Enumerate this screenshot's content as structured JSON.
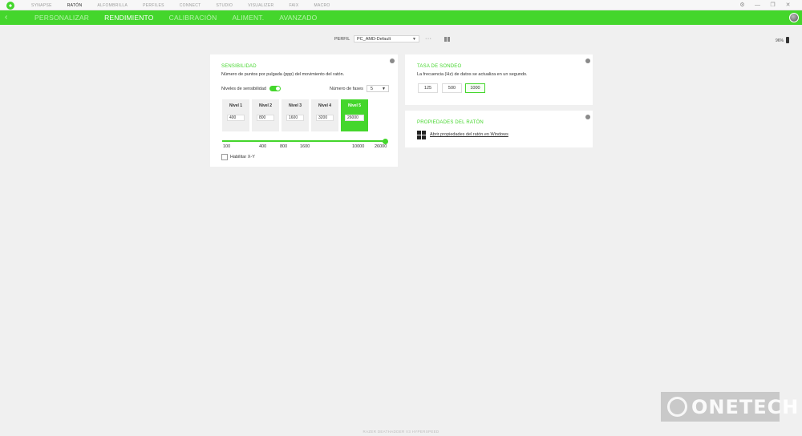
{
  "topnav": {
    "items": [
      "SYNAPSE",
      "RATÓN",
      "ALFOMBRILLA",
      "PERFILES",
      "CONNECT",
      "STUDIO",
      "VISUALIZER",
      "FAIX",
      "MACRO"
    ],
    "active_index": 1
  },
  "window_controls": {
    "settings": "⚙",
    "minimize": "—",
    "maximize": "❐",
    "close": "✕"
  },
  "subnav": {
    "back": "‹",
    "tabs": [
      "PERSONALIZAR",
      "RENDIMIENTO",
      "CALIBRACIÓN",
      "ALIMENT.",
      "AVANZADO"
    ],
    "active_index": 1
  },
  "profile": {
    "label": "PERFIL",
    "value": "PC_AMD-Default",
    "more": "···"
  },
  "battery": {
    "text": "96%"
  },
  "sensitivity": {
    "title": "SENSIBILIDAD",
    "description": "Número de puntos por pulgada (ppp) del movimiento del ratón.",
    "toggle_label": "Niveles de sensibilidad",
    "toggle_on": true,
    "stages_label": "Número de fases",
    "stages_value": "5",
    "levels": [
      {
        "name": "Nivel 1",
        "value": "400"
      },
      {
        "name": "Nivel 2",
        "value": "800"
      },
      {
        "name": "Nivel 3",
        "value": "1600"
      },
      {
        "name": "Nivel 4",
        "value": "3200"
      },
      {
        "name": "Nivel 5",
        "value": "26000"
      }
    ],
    "active_level_index": 4,
    "slider_ticks": [
      "100",
      "400",
      "800",
      "1600",
      "10000",
      "26000"
    ],
    "slider_value": 26000,
    "xy_label": "Habilitar X-Y",
    "xy_checked": false
  },
  "polling": {
    "title": "TASA DE SONDEO",
    "description": "La frecuencia (Hz) de datos se actualiza en un segundo.",
    "options": [
      "125",
      "500",
      "1000"
    ],
    "selected_index": 2
  },
  "mouse_properties": {
    "title": "PROPIEDADES DEL RATÓN",
    "link": "Abrir propiedades del ratón en Windows"
  },
  "watermark": {
    "text": "ONETECH"
  },
  "footer": {
    "text": "RAZER DEATHADDER V3 HYPERSPEED"
  },
  "colors": {
    "accent": "#44d62c",
    "panel": "#ffffff",
    "background": "#f0f0f0"
  }
}
